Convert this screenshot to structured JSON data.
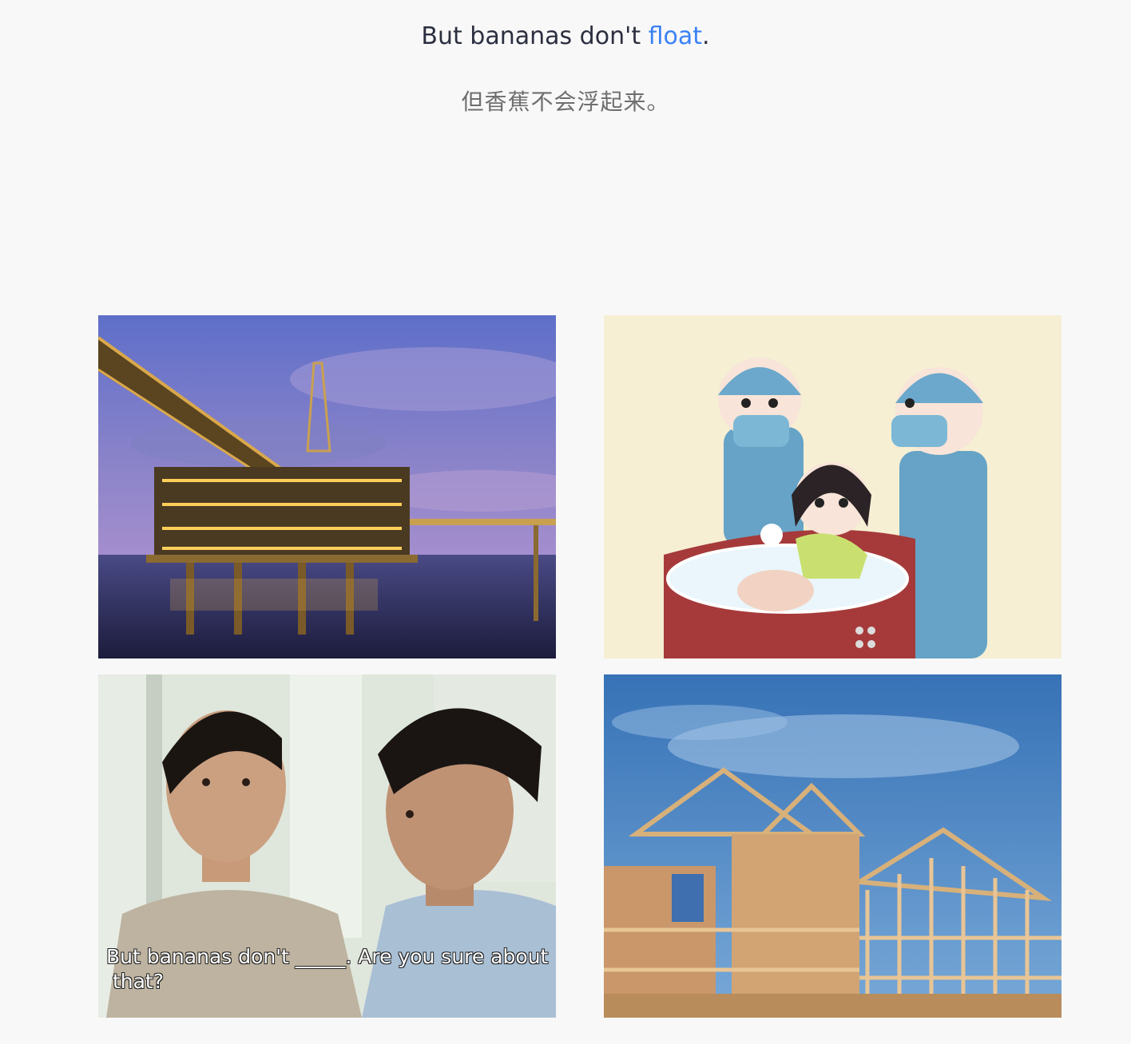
{
  "sentence": {
    "before": "But bananas don't ",
    "keyword": "float",
    "after": "."
  },
  "translation": "但香蕉不会浮起来。",
  "options": [
    {
      "id": "oil-rig",
      "caption": ""
    },
    {
      "id": "cartoon-doctors",
      "caption": ""
    },
    {
      "id": "movie-still",
      "caption": "But bananas don't _____. Are you sure about\n that?"
    },
    {
      "id": "house-frame",
      "caption": ""
    }
  ]
}
